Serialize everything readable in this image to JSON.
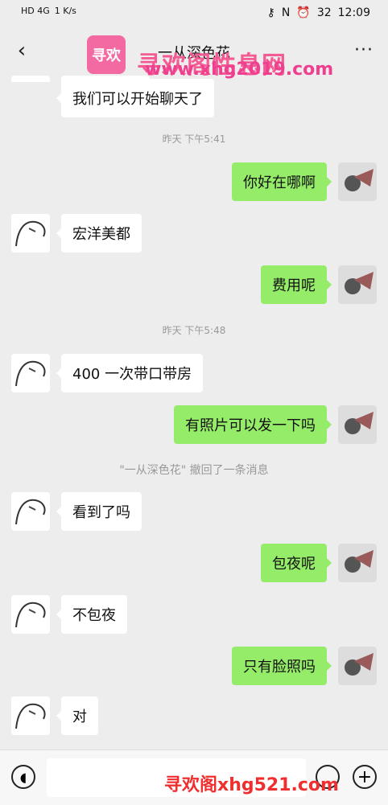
{
  "status_bar": {
    "network": "HD 4G",
    "speed": "1 K/s",
    "battery": "32",
    "time": "12:09"
  },
  "header": {
    "title": "一从深色花",
    "back_icon": "chevron-left-icon",
    "more_icon": "more-dots-icon"
  },
  "watermarks": {
    "logo": "寻欢",
    "title": "寻欢阁性息网",
    "url_top": "www.xhg2019.com",
    "url_bottom": "寻欢阁xhg521.com"
  },
  "messages": [
    {
      "side": "left",
      "text": "我们可以开始聊天了"
    },
    {
      "side": "time",
      "text": "昨天 下午5:41"
    },
    {
      "side": "right",
      "text": "你好在哪啊"
    },
    {
      "side": "left",
      "text": "宏洋美都"
    },
    {
      "side": "right",
      "text": "费用呢"
    },
    {
      "side": "time",
      "text": "昨天 下午5:48"
    },
    {
      "side": "left",
      "text": "400 一次带口带房"
    },
    {
      "side": "right",
      "text": "有照片可以发一下吗"
    },
    {
      "side": "system",
      "text": "\"一从深色花\" 撤回了一条消息"
    },
    {
      "side": "left",
      "text": "看到了吗"
    },
    {
      "side": "right",
      "text": "包夜呢"
    },
    {
      "side": "left",
      "text": "不包夜"
    },
    {
      "side": "right",
      "text": "只有脸照吗"
    },
    {
      "side": "left",
      "text": "对"
    }
  ],
  "input_bar": {
    "placeholder": "",
    "voice_icon": "voice-icon",
    "emoji_icon": "emoji-icon",
    "plus_icon": "plus-icon"
  },
  "colors": {
    "background": "#ededed",
    "bubble_right": "#95ec69",
    "bubble_left": "#ffffff"
  }
}
